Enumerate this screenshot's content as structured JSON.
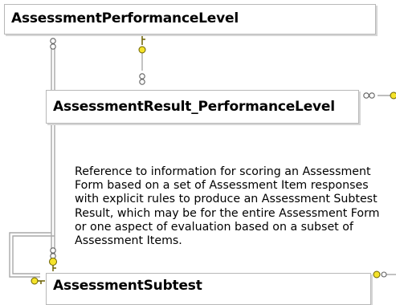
{
  "entities": {
    "assessment_performance_level": {
      "title": "AssessmentPerformanceLevel"
    },
    "assessment_result_performance_level": {
      "title": "AssessmentResult_PerformanceLevel"
    },
    "assessment_subtest": {
      "title": "AssessmentSubtest"
    }
  },
  "description": "Reference to information for scoring an Assessment Form based on a set of Assessment Item responses with explicit rules to produce an Assessment Subtest Result, which may be for the entire Assessment Form or one aspect of evaluation based on a subset of Assessment Items.",
  "icons": {
    "foreign_key": "key-icon",
    "relationship_end_many": "ring-chain-icon"
  },
  "colors": {
    "key": "#f5e32b",
    "border": "#b8b8b8",
    "connector": "#a9a9a9"
  }
}
